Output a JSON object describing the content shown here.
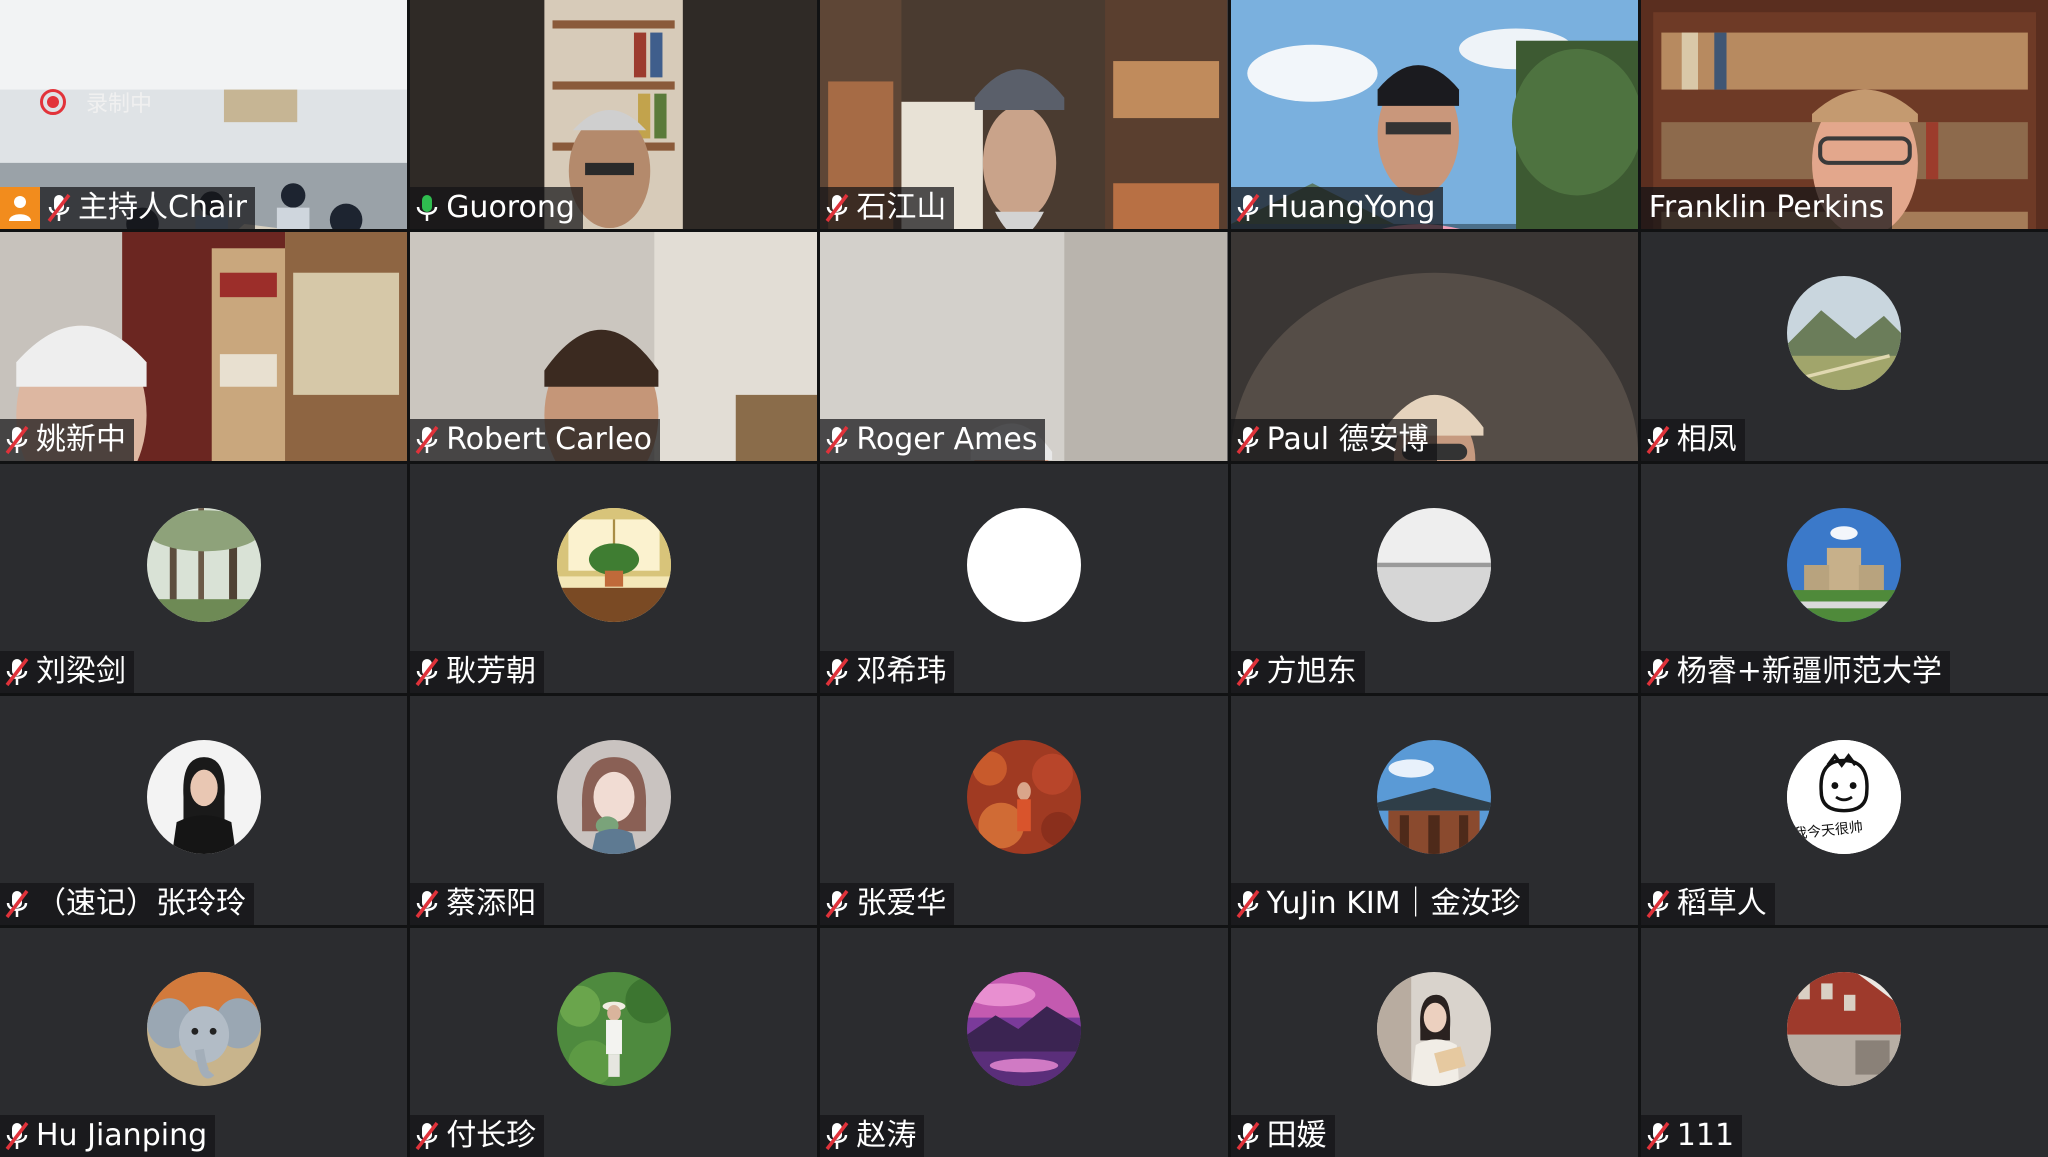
{
  "recording_label": "录制中",
  "participants": [
    {
      "name": "主持人Chair",
      "host": true,
      "mic": "muted",
      "type": "video"
    },
    {
      "name": "Guorong",
      "mic": "on",
      "type": "video",
      "active": true
    },
    {
      "name": "石江山",
      "mic": "muted",
      "type": "video"
    },
    {
      "name": "HuangYong",
      "mic": "muted",
      "type": "video"
    },
    {
      "name": "Franklin Perkins",
      "mic": "none",
      "type": "video"
    },
    {
      "name": "姚新中",
      "mic": "muted",
      "type": "video"
    },
    {
      "name": "Robert Carleo",
      "mic": "muted",
      "type": "video"
    },
    {
      "name": "Roger Ames",
      "mic": "muted",
      "type": "video"
    },
    {
      "name": "Paul 德安博",
      "mic": "muted",
      "type": "video"
    },
    {
      "name": "相凤",
      "mic": "muted",
      "type": "avatar",
      "avatar": "hills-landscape"
    },
    {
      "name": "刘梁剑",
      "mic": "muted",
      "type": "avatar",
      "avatar": "forest"
    },
    {
      "name": "耿芳朝",
      "mic": "muted",
      "type": "avatar",
      "avatar": "potted-plant"
    },
    {
      "name": "邓希玮",
      "mic": "muted",
      "type": "avatar",
      "avatar": "blank-white"
    },
    {
      "name": "方旭东",
      "mic": "muted",
      "type": "avatar",
      "avatar": "grey-sea"
    },
    {
      "name": "杨睿+新疆师范大学",
      "mic": "muted",
      "type": "avatar",
      "avatar": "campus-building"
    },
    {
      "name": "（速记）张玲玲",
      "mic": "muted",
      "type": "avatar",
      "avatar": "woman-portrait"
    },
    {
      "name": "蔡添阳",
      "mic": "muted",
      "type": "avatar",
      "avatar": "anime-girl"
    },
    {
      "name": "张爱华",
      "mic": "muted",
      "type": "avatar",
      "avatar": "autumn-foliage"
    },
    {
      "name": "YuJin KIM｜金汝珍",
      "mic": "muted",
      "type": "avatar",
      "avatar": "temple-roof"
    },
    {
      "name": "稻草人",
      "mic": "muted",
      "type": "avatar",
      "avatar": "cartoon-sketch",
      "avatar_text": "我今天很帅"
    },
    {
      "name": "Hu Jianping",
      "mic": "muted",
      "type": "avatar",
      "avatar": "elephant"
    },
    {
      "name": "付长珍",
      "mic": "muted",
      "type": "avatar",
      "avatar": "garden-figure"
    },
    {
      "name": "赵涛",
      "mic": "muted",
      "type": "avatar",
      "avatar": "purple-sunset"
    },
    {
      "name": "田媛",
      "mic": "muted",
      "type": "avatar",
      "avatar": "woman-reading"
    },
    {
      "name": "111",
      "mic": "muted",
      "type": "avatar",
      "avatar": "red-building"
    }
  ],
  "colors": {
    "muted_mic": "#e0323a",
    "active_mic": "#2fbd4f",
    "host_badge": "#f28c1d",
    "tile_bg": "#2b2c2f"
  }
}
